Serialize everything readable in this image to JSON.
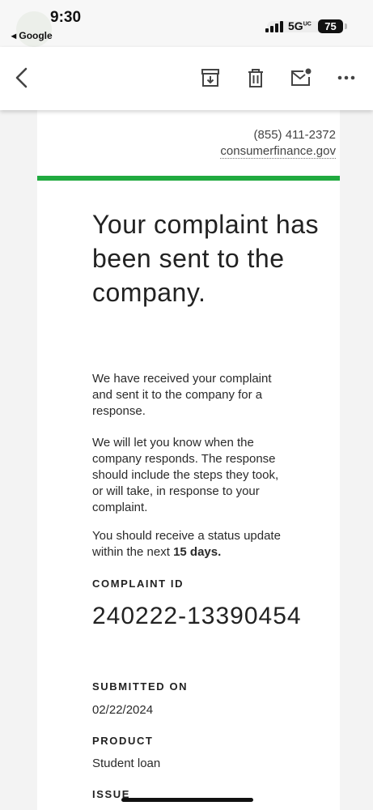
{
  "status_bar": {
    "time": "9:30",
    "back_app": "◂ Google",
    "network": "5G",
    "network_sup": "UC",
    "battery": "75"
  },
  "toolbar": {
    "icons": [
      "back-arrow-icon",
      "archive-icon",
      "trash-icon",
      "mark-unread-icon",
      "more-icon"
    ]
  },
  "email": {
    "phone": "(855) 411-2372",
    "site": "consumerfinance.gov",
    "accent_color": "#20aa3f",
    "headline": "Your complaint has been sent to the company.",
    "para1": "We have received your complaint and sent it to the company for a response.",
    "para2": "We will let you know when the company responds. The response should include the steps they took, or will take, in response to your complaint.",
    "para3_prefix": "You should receive a status update within the next ",
    "para3_bold": "15 days.",
    "complaint_id_label": "COMPLAINT ID",
    "complaint_id": "240222-13390454",
    "submitted_label": "SUBMITTED ON",
    "submitted_value": "02/22/2024",
    "product_label": "PRODUCT",
    "product_value": "Student loan",
    "issue_label": "ISSUE"
  }
}
